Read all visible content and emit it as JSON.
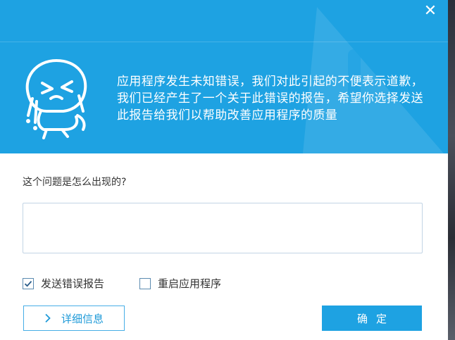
{
  "dialog": {
    "close_glyph": "✕",
    "message": "应用程序发生未知错误，我们对此引起的不便表示道歉，我们已经产生了一个关于此错误的报告，希望你选择发送此报告给我们以帮助改善应用程序的质量",
    "mascot": "crying-mascot",
    "watermark": "warning-triangle-watermark",
    "question_label": "这个问题是怎么出现的?",
    "answer": {
      "value": "",
      "placeholder": ""
    },
    "options": [
      {
        "label": "发送错误报告",
        "checked": true
      },
      {
        "label": "重启应用程序",
        "checked": false
      }
    ],
    "details_button": "详细信息",
    "ok_button": "确定"
  },
  "colors": {
    "header": "#1ea2e2",
    "accent": "#1e9ad8",
    "checkbox_border": "#5b8ab0"
  }
}
